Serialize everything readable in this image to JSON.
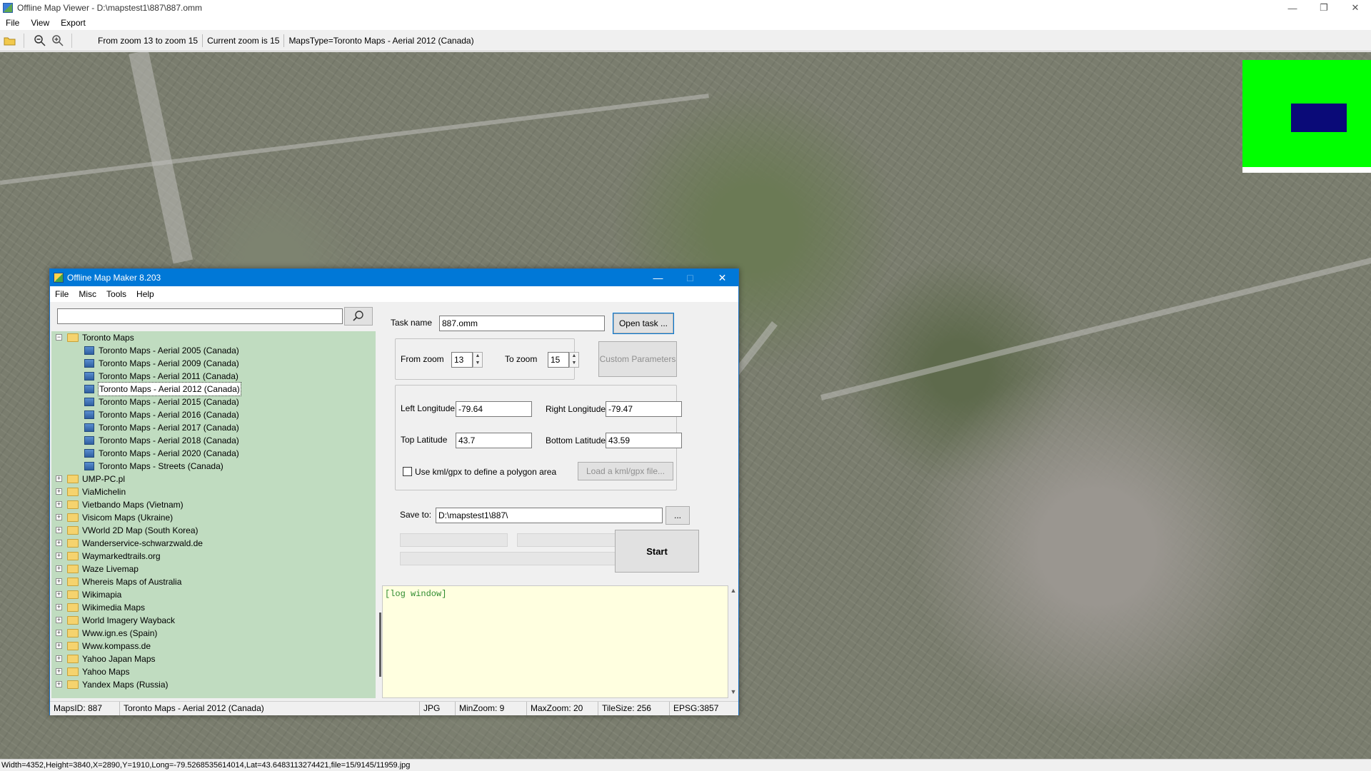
{
  "viewer": {
    "title": "Offline Map Viewer - D:\\mapstest1\\887\\887.omm",
    "menu": [
      "File",
      "View",
      "Export"
    ],
    "toolbar": {
      "zoom_range": "From zoom 13 to zoom 15",
      "current_zoom": "Current zoom is 15",
      "maps_type": "MapsType=Toronto Maps - Aerial 2012 (Canada)"
    },
    "window_controls": [
      "—",
      "❐",
      "✕"
    ],
    "status": "Width=4352,Height=3840,X=2890,Y=1910,Long=-79.5268535614014,Lat=43.6483113274421,file=15/9145/11959.jpg",
    "minimap_color": "#00ff00",
    "minimap_viewport_color": "#0a0a78"
  },
  "dialog": {
    "title": "Offline Map Maker 8.203",
    "menu": [
      "File",
      "Misc",
      "Tools",
      "Help"
    ],
    "search_value": "",
    "tree": {
      "root": "Toronto Maps",
      "children": [
        "Toronto Maps - Aerial 2005 (Canada)",
        "Toronto Maps - Aerial 2009 (Canada)",
        "Toronto Maps - Aerial 2011 (Canada)",
        "Toronto Maps - Aerial 2012 (Canada)",
        "Toronto Maps - Aerial 2015 (Canada)",
        "Toronto Maps - Aerial 2016 (Canada)",
        "Toronto Maps - Aerial 2017 (Canada)",
        "Toronto Maps - Aerial 2018 (Canada)",
        "Toronto Maps - Aerial 2020 (Canada)",
        "Toronto Maps - Streets (Canada)"
      ],
      "selected_child": 3,
      "folders": [
        "UMP-PC.pl",
        "ViaMichelin",
        "Vietbando Maps (Vietnam)",
        "Visicom Maps (Ukraine)",
        "VWorld 2D Map (South Korea)",
        "Wanderservice-schwarzwald.de",
        "Waymarkedtrails.org",
        "Waze Livemap",
        "Whereis Maps of Australia",
        "Wikimapia",
        "Wikimedia Maps",
        "World Imagery Wayback",
        "Www.ign.es (Spain)",
        "Www.kompass.de",
        "Yahoo Japan Maps",
        "Yahoo Maps",
        "Yandex Maps (Russia)"
      ]
    },
    "task_name_label": "Task name",
    "task_name_value": "887.omm",
    "open_task_label": "Open task ...",
    "from_zoom_label": "From zoom",
    "from_zoom_value": "13",
    "to_zoom_label": "To zoom",
    "to_zoom_value": "15",
    "custom_params_label": "Custom Parameters",
    "left_lon_label": "Left Longitude",
    "left_lon_value": "-79.64",
    "right_lon_label": "Right Longitude",
    "right_lon_value": "-79.47",
    "top_lat_label": "Top Latitude",
    "top_lat_value": "43.7",
    "bottom_lat_label": "Bottom Latitude",
    "bottom_lat_value": "43.59",
    "kml_checkbox_label": "Use kml/gpx to define a polygon area",
    "kml_checked": false,
    "load_kml_label": "Load a kml/gpx file...",
    "save_to_label": "Save to:",
    "save_to_value": "D:\\mapstest1\\887\\",
    "browse_label": "...",
    "start_label": "Start",
    "log_text": "[log window]",
    "status": {
      "maps_id": "MapsID: 887",
      "maps_name": "Toronto Maps - Aerial 2012 (Canada)",
      "format": "JPG",
      "min_zoom": "MinZoom: 9",
      "max_zoom": "MaxZoom: 20",
      "tile_size": "TileSize: 256",
      "epsg": "EPSG:3857"
    }
  }
}
